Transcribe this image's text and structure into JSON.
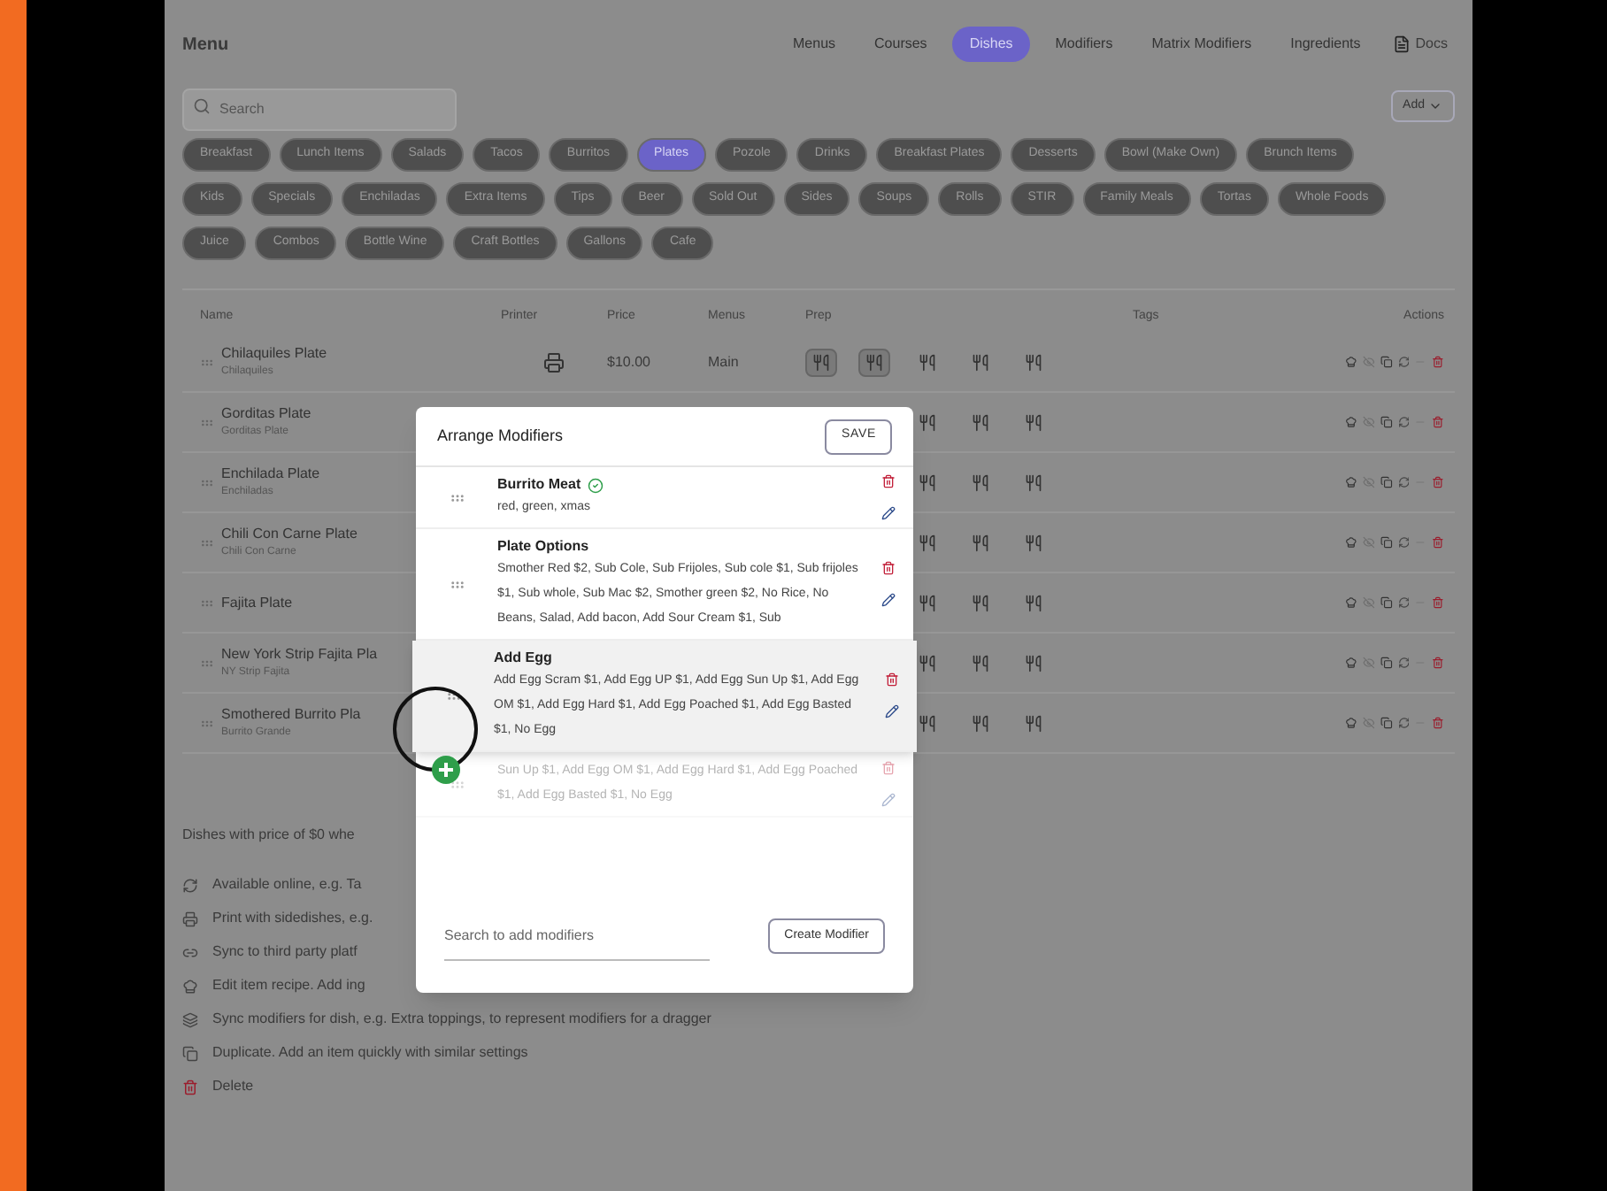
{
  "header": {
    "title": "Menu",
    "tabs": [
      {
        "label": "Menus",
        "selected": false
      },
      {
        "label": "Courses",
        "selected": false
      },
      {
        "label": "Dishes",
        "selected": true
      },
      {
        "label": "Modifiers",
        "selected": false
      },
      {
        "label": "Matrix Modifiers",
        "selected": false
      },
      {
        "label": "Ingredients",
        "selected": false
      }
    ],
    "docs": "Docs"
  },
  "search": {
    "placeholder": "Search"
  },
  "add_button": "Add",
  "categories": [
    {
      "label": "Breakfast",
      "selected": false
    },
    {
      "label": "Lunch Items",
      "selected": false
    },
    {
      "label": "Salads",
      "selected": false
    },
    {
      "label": "Tacos",
      "selected": false
    },
    {
      "label": "Burritos",
      "selected": false
    },
    {
      "label": "Plates",
      "selected": true
    },
    {
      "label": "Pozole",
      "selected": false
    },
    {
      "label": "Drinks",
      "selected": false
    },
    {
      "label": "Breakfast Plates",
      "selected": false
    },
    {
      "label": "Desserts",
      "selected": false
    },
    {
      "label": "Bowl (Make Own)",
      "selected": false
    },
    {
      "label": "Brunch Items",
      "selected": false
    },
    {
      "label": "Kids",
      "selected": false
    },
    {
      "label": "Specials",
      "selected": false
    },
    {
      "label": "Enchiladas",
      "selected": false
    },
    {
      "label": "Extra Items",
      "selected": false
    },
    {
      "label": "Tips",
      "selected": false
    },
    {
      "label": "Beer",
      "selected": false
    },
    {
      "label": "Sold Out",
      "selected": false
    },
    {
      "label": "Sides",
      "selected": false
    },
    {
      "label": "Soups",
      "selected": false
    },
    {
      "label": "Rolls",
      "selected": false
    },
    {
      "label": "STIR",
      "selected": false
    },
    {
      "label": "Family Meals",
      "selected": false
    },
    {
      "label": "Tortas",
      "selected": false
    },
    {
      "label": "Whole Foods",
      "selected": false
    },
    {
      "label": "Juice",
      "selected": false
    },
    {
      "label": "Combos",
      "selected": false
    },
    {
      "label": "Bottle Wine",
      "selected": false
    },
    {
      "label": "Craft Bottles",
      "selected": false
    },
    {
      "label": "Gallons",
      "selected": false
    },
    {
      "label": "Cafe",
      "selected": false
    }
  ],
  "table": {
    "columns": [
      "Name",
      "Printer",
      "Price",
      "Menus",
      "Prep",
      "Tags",
      "Actions"
    ],
    "rows": [
      {
        "name": "Chilaquiles Plate",
        "subtitle": "Chilaquiles",
        "price": "$10.00",
        "menus": "Main",
        "prep": [
          {
            "on": true
          },
          {
            "on": true
          },
          {
            "on": false
          },
          {
            "on": false
          },
          {
            "on": false
          }
        ]
      },
      {
        "name": "Gorditas Plate",
        "subtitle": "Gorditas Plate",
        "prep": [
          {
            "on": false
          },
          {
            "on": false
          },
          {
            "on": false
          }
        ]
      },
      {
        "name": "Enchilada Plate",
        "subtitle": "Enchiladas",
        "prep": [
          {
            "on": false
          },
          {
            "on": false
          },
          {
            "on": false
          }
        ]
      },
      {
        "name": "Chili Con Carne Plate",
        "subtitle": "Chili Con Carne",
        "prep": [
          {
            "on": false
          },
          {
            "on": false
          },
          {
            "on": false
          }
        ]
      },
      {
        "name": "Fajita Plate",
        "prep": [
          {
            "on": false
          },
          {
            "on": false
          },
          {
            "on": false
          }
        ]
      },
      {
        "name": "New York Strip Fajita Pla",
        "subtitle": "NY Strip Fajita",
        "prep": [
          {
            "on": false
          },
          {
            "on": false
          },
          {
            "on": false
          }
        ]
      },
      {
        "name": "Smothered Burrito Pla",
        "subtitle": "Burrito Grande",
        "prep": [
          {
            "on": false
          },
          {
            "on": false
          },
          {
            "on": false
          }
        ]
      }
    ]
  },
  "legend": {
    "note": "Dishes with price of $0 whe",
    "items": [
      "Available online, e.g. Ta",
      "Print with sidedishes, e.g.",
      "Sync to third party platf",
      "Edit item recipe. Add ing",
      "Sync modifiers for dish, e.g. Extra toppings, to represent modifiers for a dragger",
      "Duplicate. Add an item quickly with similar settings",
      "Delete"
    ]
  },
  "modal": {
    "title": "Arrange Modifiers",
    "save": "SAVE",
    "items": [
      {
        "kind": "normal",
        "name": "Burrito Meat",
        "verified": true,
        "options": "red, green, xmas"
      },
      {
        "kind": "normal",
        "name": "Plate Options",
        "verified": false,
        "options": "Smother Red $2, Sub Cole, Sub Frijoles, Sub cole $1, Sub frijoles $1, Sub whole, Sub Mac $2, Smother green $2, No Rice, No Beans, Salad, Add bacon, Add Sour Cream $1, Sub"
      },
      {
        "kind": "dragging",
        "name": "Add Egg",
        "verified": false,
        "options": "Add Egg Scram $1, Add Egg UP $1, Add Egg Sun Up $1, Add Egg OM $1, Add Egg Hard $1, Add Egg Poached $1, Add Egg Basted $1, No Egg"
      },
      {
        "kind": "ghost",
        "options": "Sun Up $1, Add Egg OM $1, Add Egg Hard $1, Add Egg Poached $1, Add Egg Basted $1, No Egg"
      }
    ],
    "search_placeholder": "Search to add modifiers",
    "create": "Create Modifier"
  }
}
